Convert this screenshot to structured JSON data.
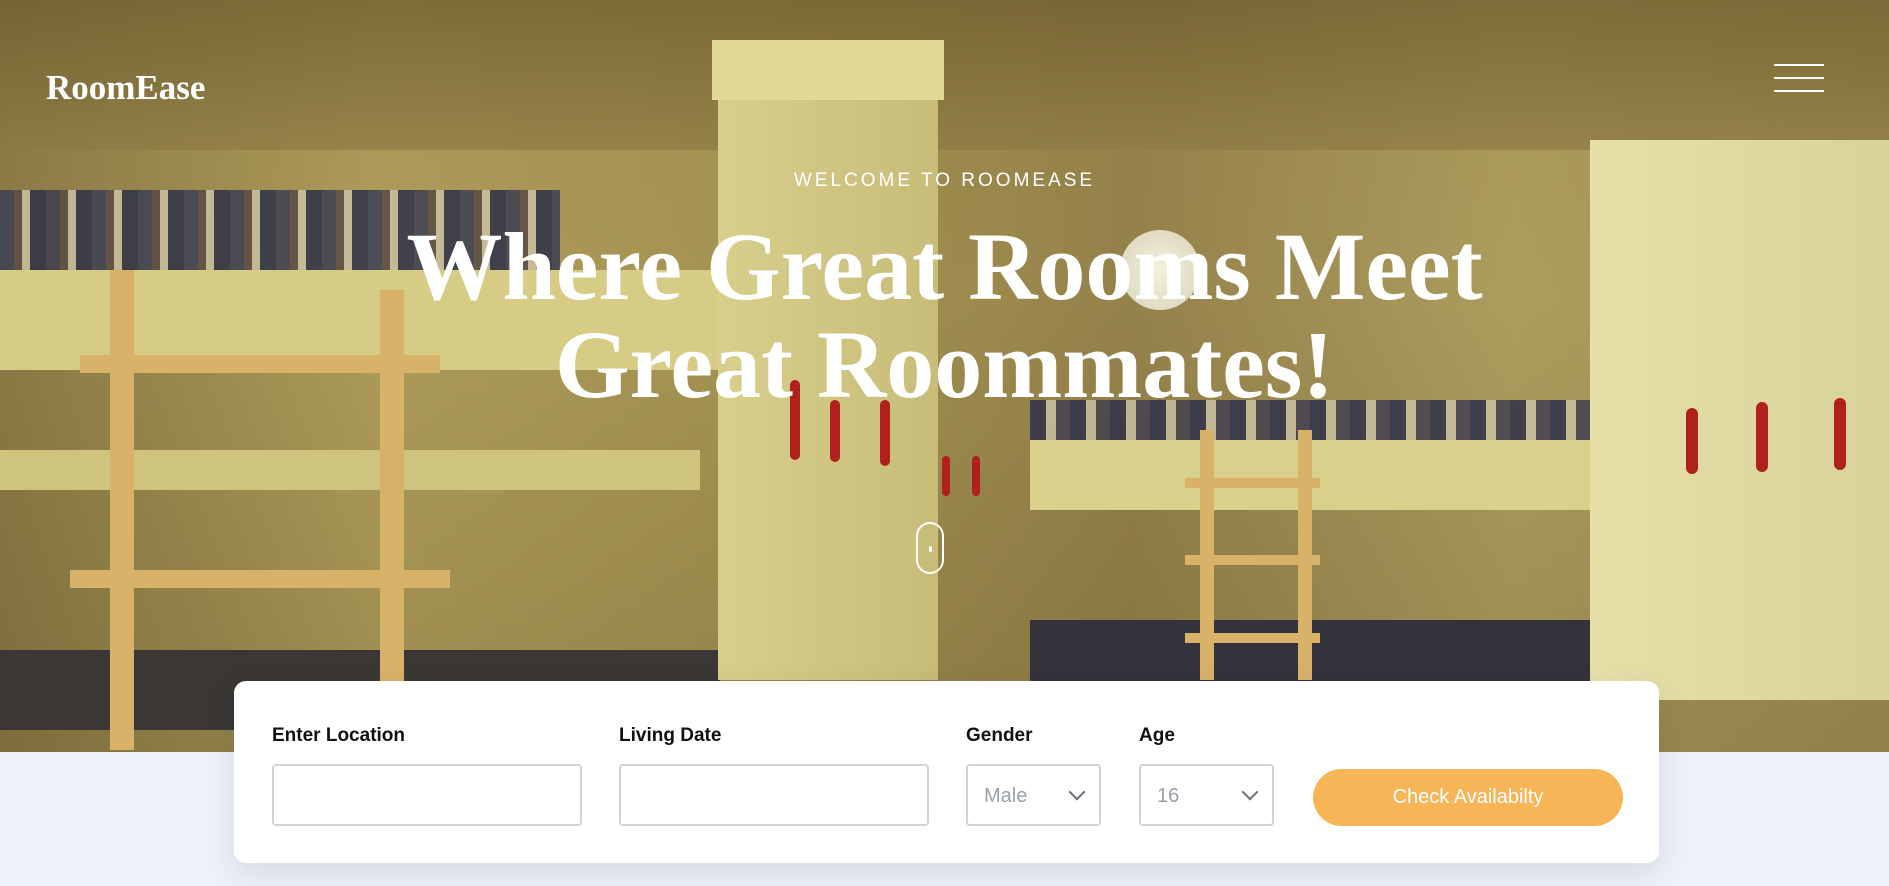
{
  "brand": {
    "logo_text": "RoomEase"
  },
  "header": {
    "menu_icon": "hamburger-menu-icon"
  },
  "hero": {
    "eyebrow": "WELCOME TO ROOMEASE",
    "headline_line1": "Where Great Rooms Meet",
    "headline_line2": "Great Roommates!",
    "scroll_icon": "mouse-scroll-icon"
  },
  "search": {
    "location_label": "Enter Location",
    "location_value": "",
    "living_date_label": "Living Date",
    "living_date_value": "",
    "gender_label": "Gender",
    "gender_selected": "Male",
    "age_label": "Age",
    "age_selected": "16",
    "submit_label": "Check Availabilty",
    "submit_color": "#f8b557"
  }
}
